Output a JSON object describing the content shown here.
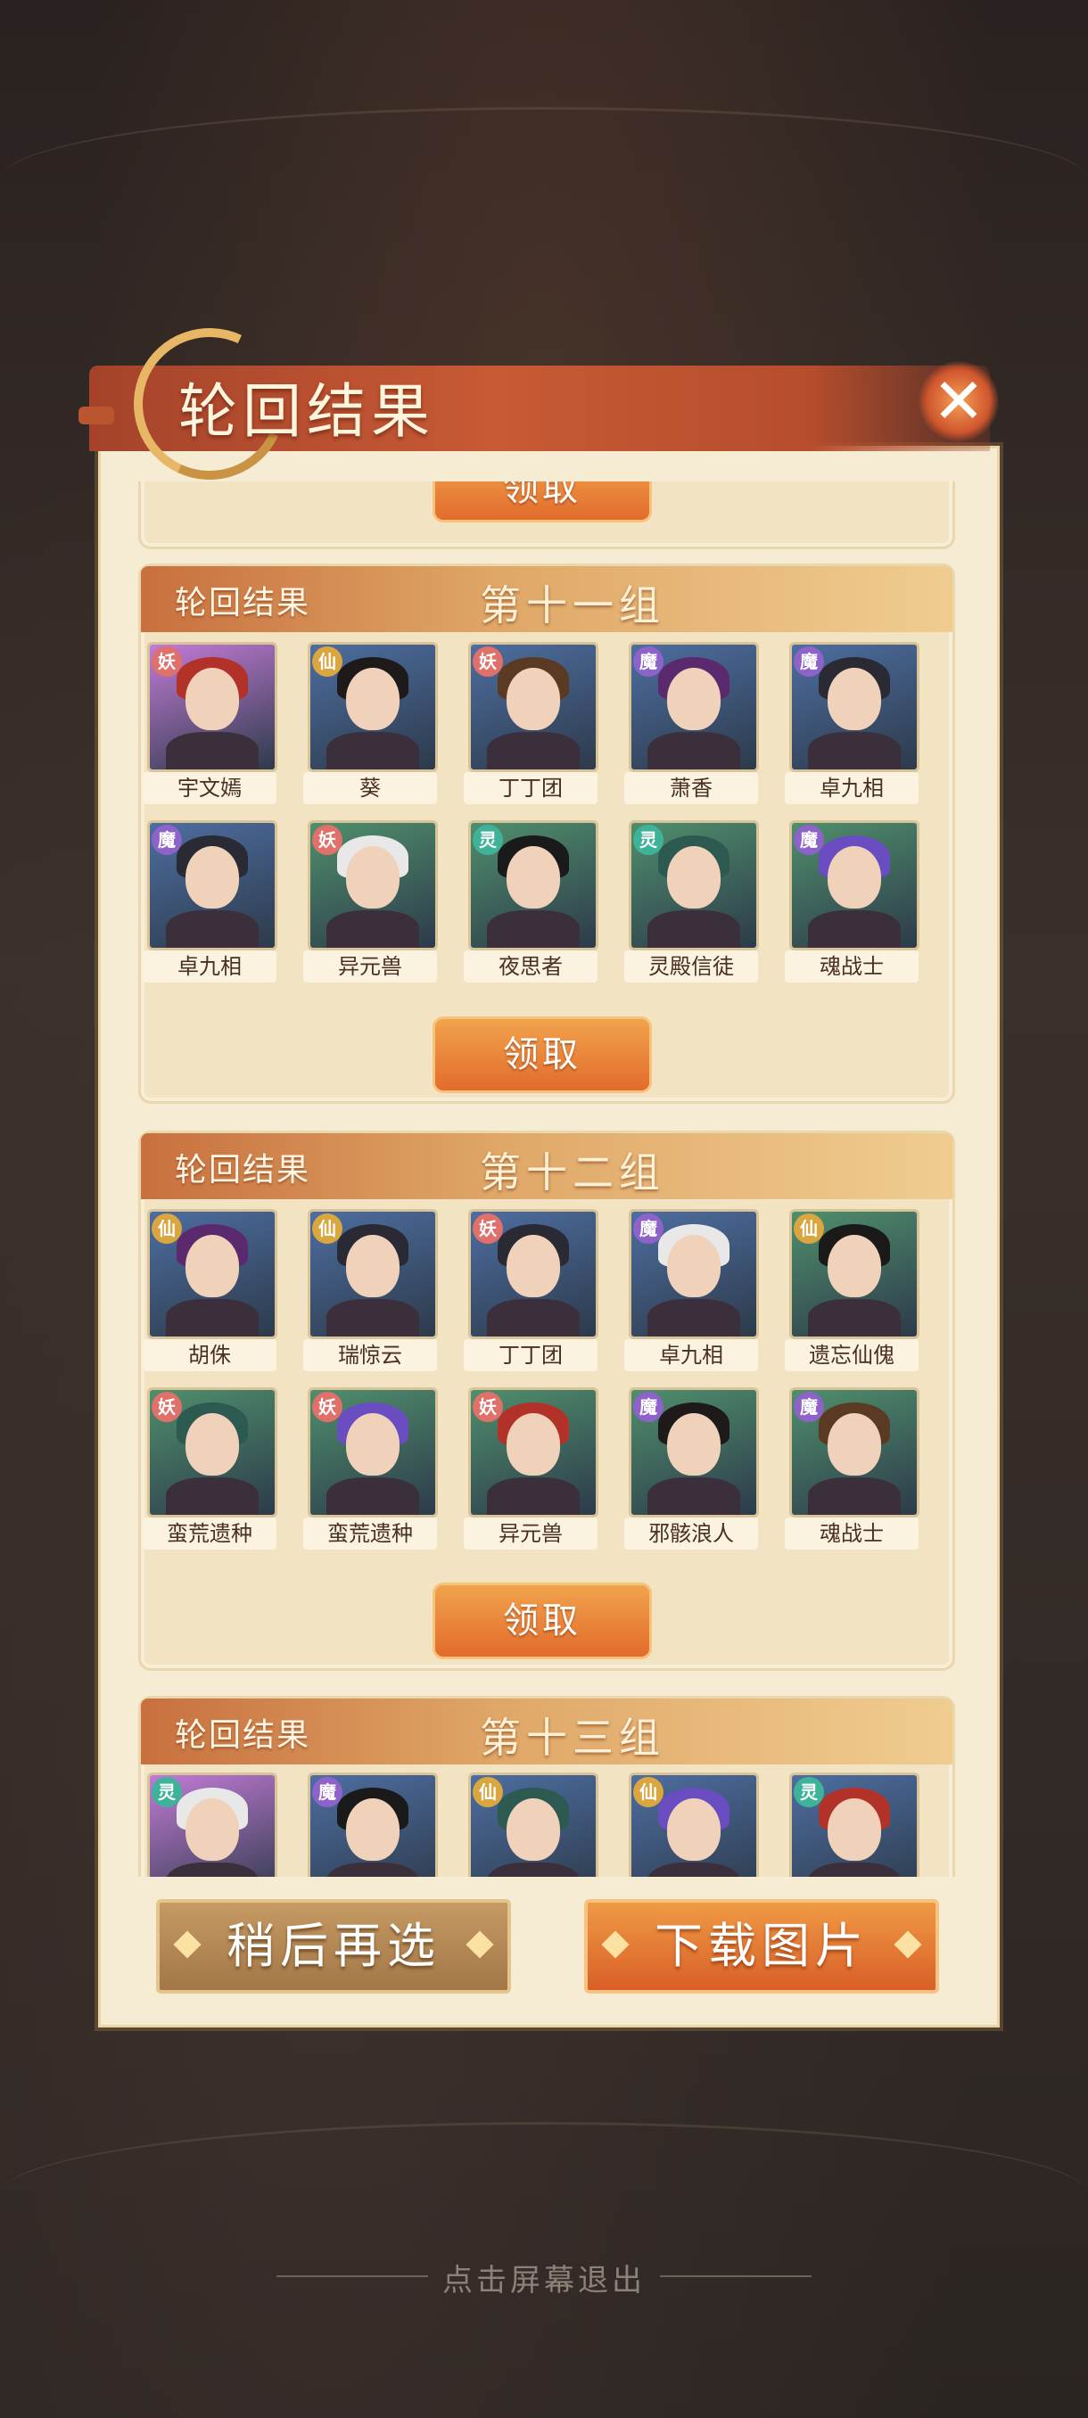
{
  "dialog": {
    "title": "轮回结果",
    "close_icon": "close-icon",
    "previous_claim_label": "领取"
  },
  "groups": [
    {
      "label": "轮回结果",
      "name": "第十一组",
      "claim_label": "领取",
      "heroes": [
        {
          "name": "宇文嫣",
          "faction": "妖",
          "color": "#c27bd6"
        },
        {
          "name": "葵",
          "faction": "仙",
          "color": "#4d6ea1"
        },
        {
          "name": "丁丁团",
          "faction": "妖",
          "color": "#4d6ea1"
        },
        {
          "name": "萧香",
          "faction": "魔",
          "color": "#4d6ea1"
        },
        {
          "name": "卓九相",
          "faction": "魔",
          "color": "#4d6ea1"
        },
        {
          "name": "卓九相",
          "faction": "魔",
          "color": "#4d6ea1"
        },
        {
          "name": "异元兽",
          "faction": "妖",
          "color": "#4f8f6c"
        },
        {
          "name": "夜思者",
          "faction": "灵",
          "color": "#4f8f6c"
        },
        {
          "name": "灵殿信徒",
          "faction": "灵",
          "color": "#4f8f6c"
        },
        {
          "name": "魂战士",
          "faction": "魔",
          "color": "#4f8f6c"
        }
      ]
    },
    {
      "label": "轮回结果",
      "name": "第十二组",
      "claim_label": "领取",
      "heroes": [
        {
          "name": "胡侏",
          "faction": "仙",
          "color": "#4d6ea1"
        },
        {
          "name": "瑞惊云",
          "faction": "仙",
          "color": "#4d6ea1"
        },
        {
          "name": "丁丁团",
          "faction": "妖",
          "color": "#4d6ea1"
        },
        {
          "name": "卓九相",
          "faction": "魔",
          "color": "#4d6ea1"
        },
        {
          "name": "遗忘仙傀",
          "faction": "仙",
          "color": "#4f8f6c"
        },
        {
          "name": "蛮荒遗种",
          "faction": "妖",
          "color": "#4f8f6c"
        },
        {
          "name": "蛮荒遗种",
          "faction": "妖",
          "color": "#4f8f6c"
        },
        {
          "name": "异元兽",
          "faction": "妖",
          "color": "#4f8f6c"
        },
        {
          "name": "邪骸浪人",
          "faction": "魔",
          "color": "#4f8f6c"
        },
        {
          "name": "魂战士",
          "faction": "魔",
          "color": "#4f8f6c"
        }
      ]
    },
    {
      "label": "轮回结果",
      "name": "第十三组",
      "heroes": [
        {
          "faction": "灵",
          "color": "#c27bd6"
        },
        {
          "faction": "魔",
          "color": "#4d6ea1"
        },
        {
          "faction": "仙",
          "color": "#4d6ea1"
        },
        {
          "faction": "仙",
          "color": "#4d6ea1"
        },
        {
          "faction": "灵",
          "color": "#4d6ea1"
        }
      ]
    }
  ],
  "footer": {
    "later_label": "稍后再选",
    "download_label": "下载图片"
  },
  "exit_hint": "点击屏幕退出",
  "faction_colors": {
    "妖": "#e0706a",
    "仙": "#d9a640",
    "魔": "#8d63c9",
    "灵": "#3fb39a"
  }
}
